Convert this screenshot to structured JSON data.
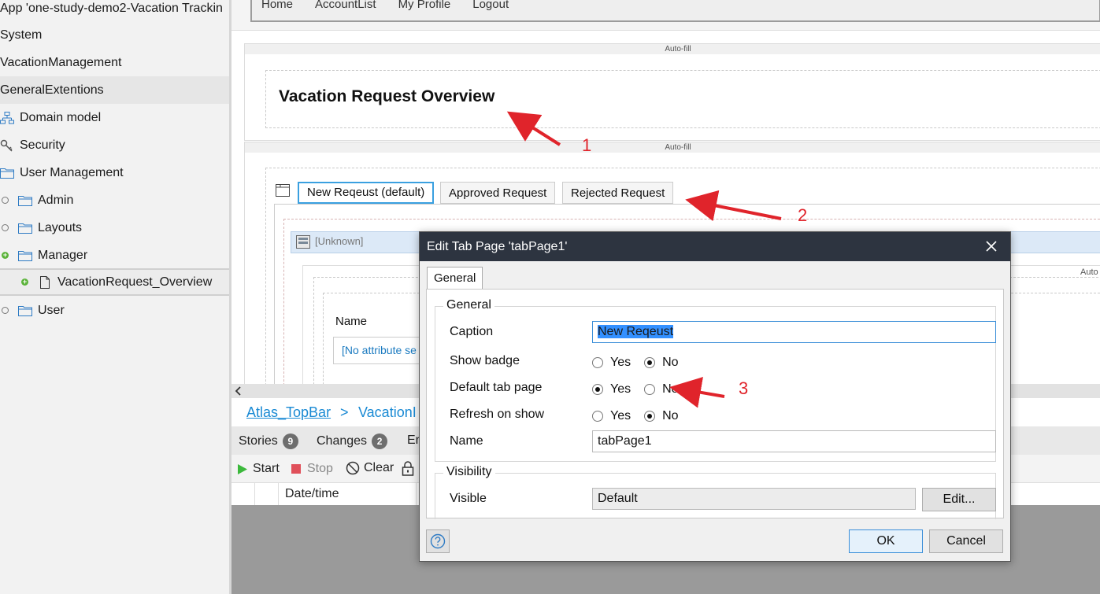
{
  "tree": {
    "app_title": "App 'one-study-demo2-Vacation Trackin",
    "items": [
      {
        "label": "System"
      },
      {
        "label": "VacationManagement"
      },
      {
        "label": "GeneralExtentions"
      },
      {
        "label": "Domain model",
        "icon": "domain-model-icon"
      },
      {
        "label": "Security",
        "icon": "key-icon"
      },
      {
        "label": "User Management",
        "icon": "folder-icon"
      },
      {
        "label": "Admin",
        "icon": "folder-icon"
      },
      {
        "label": "Layouts",
        "icon": "folder-icon"
      },
      {
        "label": "Manager",
        "icon": "folder-icon"
      },
      {
        "label": "VacationRequest_Overview",
        "icon": "page-icon"
      },
      {
        "label": "User",
        "icon": "folder-icon"
      }
    ]
  },
  "editor": {
    "nav_items": [
      "Home",
      "AccountList",
      "My Profile",
      "Logout"
    ],
    "autofill_label": "Auto-fill",
    "page_title": "Vacation Request Overview",
    "tabs": [
      {
        "label": "New Reqeust (default)",
        "active": true
      },
      {
        "label": "Approved Request",
        "active": false
      },
      {
        "label": "Rejected Request",
        "active": false
      }
    ],
    "unknown_label": "[Unknown]",
    "auto_label": "Auto",
    "name_label": "Name",
    "attr_placeholder": "[No attribute se"
  },
  "breadcrumb": {
    "items": [
      "Atlas_TopBar",
      "VacationI"
    ],
    "separator": ">"
  },
  "bottom_panel": {
    "tabs": [
      {
        "label": "Stories",
        "count": "9"
      },
      {
        "label": "Changes",
        "count": "2"
      },
      {
        "label": "Er"
      }
    ],
    "toolbar": {
      "start": "Start",
      "stop": "Stop",
      "clear": "Clear"
    },
    "column_header": "Date/time"
  },
  "dialog": {
    "title": "Edit Tab Page 'tabPage1'",
    "tab": "General",
    "general_group": "General",
    "caption_label": "Caption",
    "caption_value": "New Reqeust",
    "show_badge_label": "Show badge",
    "default_tab_label": "Default tab page",
    "refresh_label": "Refresh on show",
    "name_label": "Name",
    "name_value": "tabPage1",
    "yes": "Yes",
    "no": "No",
    "visibility_group": "Visibility",
    "visible_label": "Visible",
    "visible_value": "Default",
    "edit_button": "Edit...",
    "ok_button": "OK",
    "cancel_button": "Cancel",
    "show_badge": "No",
    "default_tab_page": "Yes",
    "refresh_on_show": "No"
  },
  "annotations": [
    "1",
    "2",
    "3"
  ],
  "colors": {
    "annotation": "#e0242b",
    "titlebar": "#2d3440",
    "focus": "#3a8ed8",
    "link": "#1a8ad4"
  }
}
